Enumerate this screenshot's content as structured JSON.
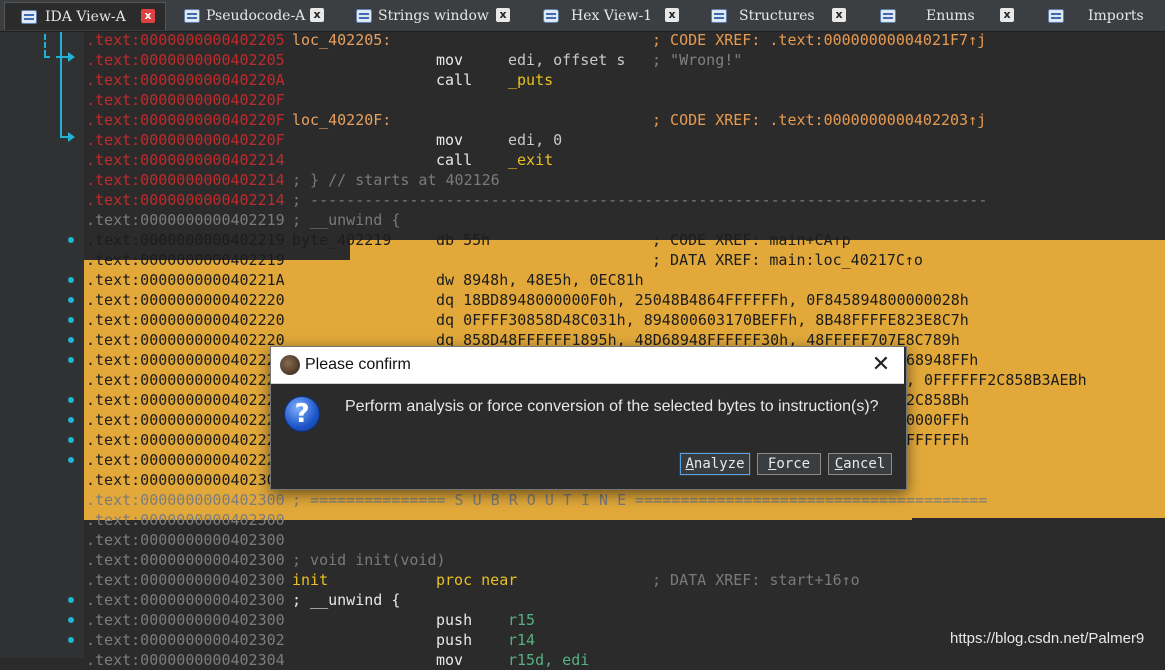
{
  "tabs": [
    {
      "label": "IDA View-A",
      "close": "x",
      "active": true
    },
    {
      "label": "Pseudocode-A",
      "close": "x"
    },
    {
      "label": "Strings window",
      "close": "x"
    },
    {
      "label": "Hex View-1",
      "close": "x"
    },
    {
      "label": "Structures",
      "close": "x"
    },
    {
      "label": "Enums",
      "close": "x"
    },
    {
      "label": "Imports",
      "close": ""
    }
  ],
  "listing": [
    {
      "addr": ".text:0000000000402205",
      "label": "loc_402205:",
      "comment": "; CODE XREF: .text:00000000004021F7↑j"
    },
    {
      "addr": ".text:0000000000402205",
      "mnem": "mov",
      "ops": "edi, offset s",
      "comment": "; \"Wrong!\""
    },
    {
      "addr": ".text:000000000040220A",
      "mnem": "call",
      "ops": "_puts"
    },
    {
      "addr": ".text:000000000040220F"
    },
    {
      "addr": ".text:000000000040220F",
      "label": "loc_40220F:",
      "comment": "; CODE XREF: .text:0000000000402203↑j"
    },
    {
      "addr": ".text:000000000040220F",
      "mnem": "mov",
      "ops": "edi, 0"
    },
    {
      "addr": ".text:0000000000402214",
      "mnem": "call",
      "ops": "_exit"
    },
    {
      "addr": ".text:0000000000402214",
      "label": "; } // starts at 402126"
    },
    {
      "addr": ".text:0000000000402214",
      "label": "; ---------------------------------------------------------------------------"
    },
    {
      "addr": ".text:0000000000402219",
      "label": "; __unwind {"
    },
    {
      "addr": ".text:0000000000402219",
      "label": "byte_402219",
      "mnem": "db 55h",
      "comment": "; CODE XREF: main+CA↑p"
    },
    {
      "addr": ".text:0000000000402219",
      "comment": "; DATA XREF: main:loc_40217C↑o"
    },
    {
      "addr": ".text:000000000040221A",
      "mnem": "dw 8948h, 48E5h, 0EC81h"
    },
    {
      "addr": ".text:0000000000402220",
      "mnem": "dq 18BD8948000000F0h, 25048B4864FFFFFFh, 0F845894800000028h"
    },
    {
      "addr": ".text:0000000000402220",
      "mnem": "dq 0FFFF30858D48C031h, 894800603170BEFFh, 8B48FFFFE823E8C7h"
    },
    {
      "addr": ".text:0000000000402220",
      "mnem": "dq 858D48FFFFFF1895h, 48D68948FFFFFF30h, 48FFFFF707E8C789h"
    },
    {
      "addr": ".text:000000000040222",
      "mnem": "",
      "tail": "68948FFh"
    },
    {
      "addr": ".text:000000000040222",
      "mnem": "",
      "tail": ", 0FFFFFF2C858B3AEBh"
    },
    {
      "addr": ".text:000000000040222",
      "mnem": "",
      "tail": "2C858Bh"
    },
    {
      "addr": ".text:000000000040222",
      "mnem": "",
      "tail": "0000FFh"
    },
    {
      "addr": ".text:000000000040222",
      "mnem": "",
      "tail": "FFFFFFh"
    },
    {
      "addr": ".text:000000000040222"
    },
    {
      "addr": ".text:000000000040230"
    },
    {
      "addr": ".text:0000000000402300",
      "label": "; =============== S U B R O U T I N E ======================================="
    },
    {
      "addr": ".text:0000000000402300"
    },
    {
      "addr": ".text:0000000000402300"
    },
    {
      "addr": ".text:0000000000402300",
      "label": "; void init(void)"
    },
    {
      "addr": ".text:0000000000402300",
      "label": "init",
      "mnem": "proc near",
      "comment": "; DATA XREF: start+16↑o"
    },
    {
      "addr": ".text:0000000000402300",
      "label": "; __unwind {"
    },
    {
      "addr": ".text:0000000000402300",
      "mnem": "push",
      "ops": "r15"
    },
    {
      "addr": ".text:0000000000402302",
      "mnem": "push",
      "ops": "r14"
    },
    {
      "addr": ".text:0000000000402304",
      "mnem": "mov",
      "ops": "r15d, edi"
    }
  ],
  "dialog": {
    "title": "Please confirm",
    "close": "✕",
    "question_mark": "?",
    "message": "Perform analysis or force conversion of the selected bytes to instruction(s)?",
    "buttons": {
      "analyze": {
        "hot": "A",
        "rest": "nalyze"
      },
      "force": {
        "hot": "F",
        "rest": "orce"
      },
      "cancel": {
        "hot": "C",
        "rest": "ancel"
      }
    }
  },
  "watermark": "https://blog.csdn.net/Palmer9",
  "colors": {
    "selection": "#e2a93a",
    "flow_arrow": "#21b3d6",
    "address_red": "#c02a2a"
  }
}
